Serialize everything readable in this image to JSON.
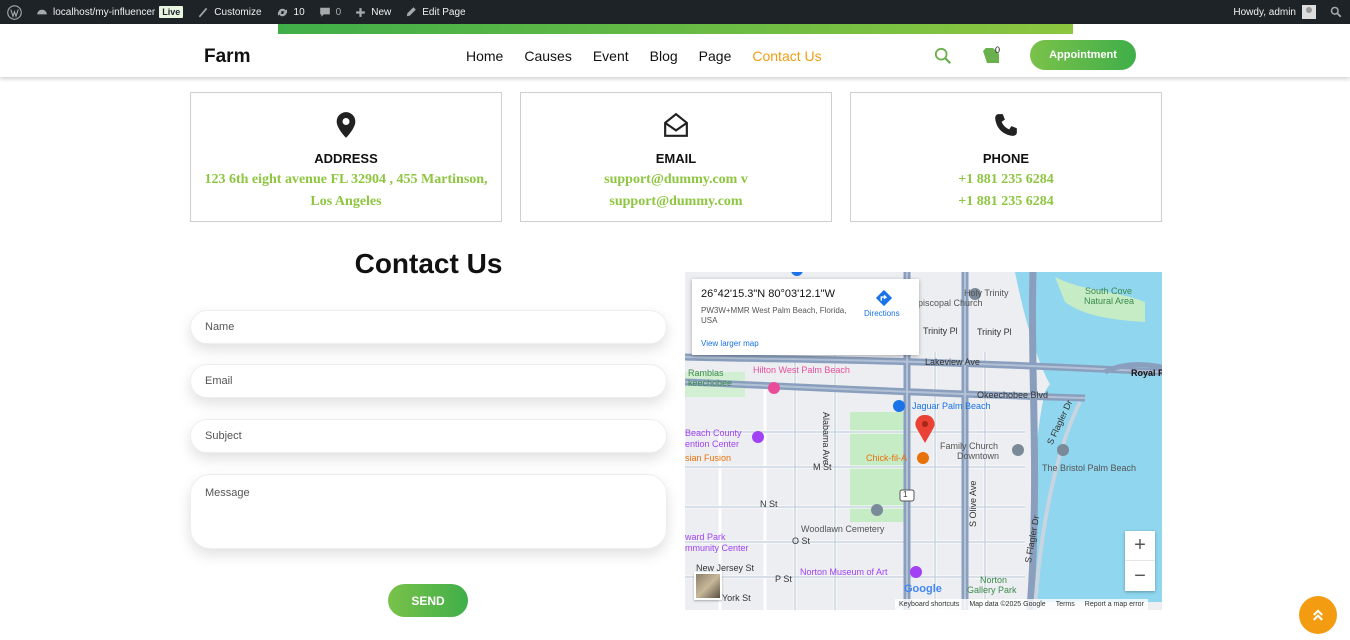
{
  "adminbar": {
    "site": "localhost/my-influencer",
    "live": "Live",
    "customize": "Customize",
    "updates": "10",
    "comments": "0",
    "new": "New",
    "edit": "Edit Page",
    "howdy": "Howdy, admin"
  },
  "header": {
    "logo": "Farm",
    "nav": [
      "Home",
      "Causes",
      "Event",
      "Blog",
      "Page",
      "Contact Us"
    ],
    "cart_count": "0",
    "appointment": "Appointment"
  },
  "cards": [
    {
      "title": "ADDRESS",
      "line1": "123 6th eight avenue FL 32904 , 455 Martinson,",
      "line2": "Los Angeles"
    },
    {
      "title": "EMAIL",
      "line1": "support@dummy.com v",
      "line2": "support@dummy.com"
    },
    {
      "title": "PHONE",
      "line1": "+1 881 235 6284",
      "line2": "+1 881 235 6284"
    }
  ],
  "form": {
    "title": "Contact Us",
    "name": "Name",
    "email": "Email",
    "subject": "Subject",
    "message": "Message",
    "send": "SEND"
  },
  "map": {
    "coords": "26°42'15.3\"N 80°03'12.1\"W",
    "address": "PW3W+MMR West Palm Beach, Florida, USA",
    "directions": "Directions",
    "larger": "View larger map",
    "labels": {
      "holy": "Holy Trinity",
      "episcopal": "piscopal Church",
      "southcove": "South Cove",
      "natural": "Natural Area",
      "trinity1": "Trinity Pl",
      "trinity2": "Trinity Pl",
      "lakeview": "Lakeview Ave",
      "ramblas": "Ramblas",
      "keechobee": "keechobee",
      "hilton": "Hilton West Palm Beach",
      "okeechobee": "Okeechobee Blvd",
      "royal": "Royal P",
      "jaguar": "Jaguar Palm Beach",
      "beachcounty": "Beach County",
      "ention": "ention Center",
      "fusion": "sian Fusion",
      "family": "Family Church",
      "downtown": "Downtown",
      "chick": "Chick-fil-A",
      "bristol": "The Bristol Palm Beach",
      "mst": "M St",
      "nst": "N St",
      "ost": "O St",
      "pst": "P St",
      "york": "York St",
      "woodlawn": "Woodlawn Cemetery",
      "ward": "ward Park",
      "community": "mmunity Center",
      "newjersey": "New Jersey St",
      "norton": "Norton Museum of Art",
      "nortong": "Norton",
      "gallery": "Gallery Park",
      "alabama": "Alabama Ave",
      "olive": "S Olive Ave",
      "flagler": "S Flagler Dr",
      "flagler2": "S Flagler Dr",
      "route": "1"
    },
    "footer": {
      "keyboard": "Keyboard shortcuts",
      "mapdata": "Map data ©2025 Google",
      "terms": "Terms",
      "report": "Report a map error"
    },
    "google": "Google",
    "water_color": "#8fd6ee",
    "park_color": "#c6ecc6"
  },
  "colors": {
    "accent": "#8dc63f",
    "nav_active": "#f39c12"
  }
}
